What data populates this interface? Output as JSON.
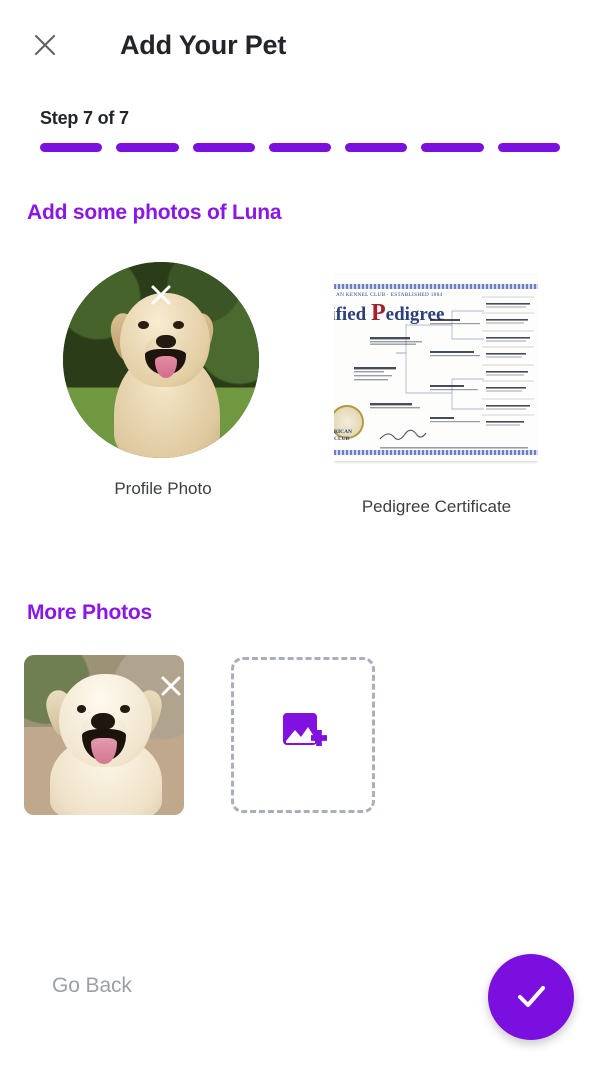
{
  "header": {
    "title": "Add Your Pet",
    "close_icon": "close-icon"
  },
  "progress": {
    "step_label": "Step 7 of 7",
    "current_step": 7,
    "total_steps": 7,
    "segments": [
      {
        "filled": true
      },
      {
        "filled": true
      },
      {
        "filled": true
      },
      {
        "filled": true
      },
      {
        "filled": true
      },
      {
        "filled": true
      },
      {
        "filled": true
      }
    ],
    "fill_color": "#7b0fe0",
    "empty_color": "#d9d9e0"
  },
  "main": {
    "heading": "Add some photos of Luna",
    "pet_name": "Luna",
    "heading_color": "#8a16e8",
    "media": [
      {
        "name": "profile-photo",
        "caption": "Profile Photo",
        "shape": "circle",
        "has_remove": true,
        "remove_icon": "close-icon",
        "alt": "Golden labrador sitting in grass with tongue out"
      },
      {
        "name": "pedigree-certificate",
        "caption": "Pedigree Certificate",
        "shape": "document",
        "has_remove": false,
        "alt": "American Kennel Club Certified Pedigree document",
        "document": {
          "org_line": "AN KENNEL CLUB · ESTABLISHED 1884",
          "title_prefix": "tified ",
          "title_ornate": "P",
          "title_rest": "edigree",
          "seal_text_line1": "RICAN",
          "seal_text_line2": "CLUB"
        }
      }
    ]
  },
  "more_photos": {
    "heading": "More Photos",
    "heading_color": "#8a16e8",
    "items": [
      {
        "name": "more-photo-thumbnail",
        "type": "photo",
        "has_remove": true,
        "remove_icon": "close-icon",
        "alt": "Close-up of a yellow labrador smiling"
      },
      {
        "name": "add-photo-tile",
        "type": "add",
        "icon": "add-image-icon",
        "icon_color": "#8011e0",
        "border_style": "dashed",
        "border_color": "#a9b0bb"
      }
    ]
  },
  "footer": {
    "back_label": "Go Back",
    "back_color": "#9aa0a6",
    "submit_icon": "check-icon",
    "submit_color": "#7b0fe0"
  }
}
